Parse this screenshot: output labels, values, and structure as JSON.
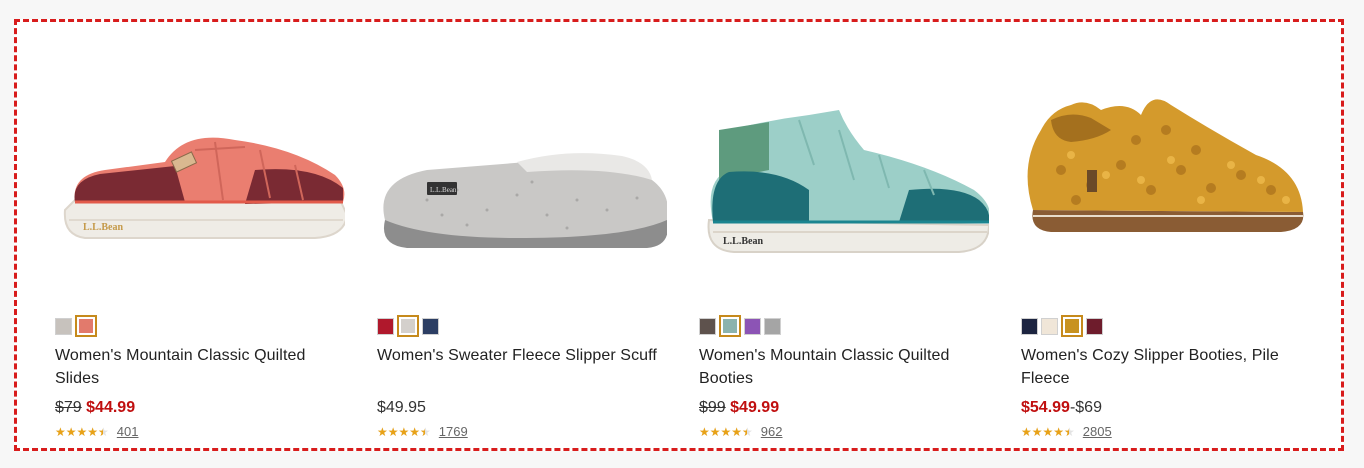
{
  "products": [
    {
      "name": "Women's Mountain Classic Quilted Slides",
      "was_price": "$79",
      "price": "$44.99",
      "price_suffix": "",
      "rating": 4.5,
      "reviews": "401",
      "colors": [
        "#c7c2bd",
        "#e27a6c"
      ],
      "selected_color": 1,
      "image": "coral-quilted-slide"
    },
    {
      "name": "Women's Sweater Fleece Slipper Scuff",
      "was_price": "",
      "price": "$49.95",
      "price_suffix": "",
      "rating": 4.5,
      "reviews": "1769",
      "colors": [
        "#b0182c",
        "#d4d0cc",
        "#2c3e63"
      ],
      "selected_color": 1,
      "image": "gray-fleece-scuff"
    },
    {
      "name": "Women's Mountain Classic Quilted Booties",
      "was_price": "$99",
      "price": "$49.99",
      "price_suffix": "",
      "rating": 4.5,
      "reviews": "962",
      "colors": [
        "#5e524d",
        "#8bb3ae",
        "#8c54b5",
        "#a5a5a5"
      ],
      "selected_color": 1,
      "image": "teal-quilted-bootie"
    },
    {
      "name": "Women's Cozy Slipper Booties, Pile Fleece",
      "was_price": "",
      "price": "$54.99",
      "price_suffix": "-$69",
      "rating": 4.5,
      "reviews": "2805",
      "colors": [
        "#1c2440",
        "#f0e6d8",
        "#c8921f",
        "#6e1c2c"
      ],
      "selected_color": 2,
      "image": "gold-pile-fleece-bootie"
    }
  ]
}
